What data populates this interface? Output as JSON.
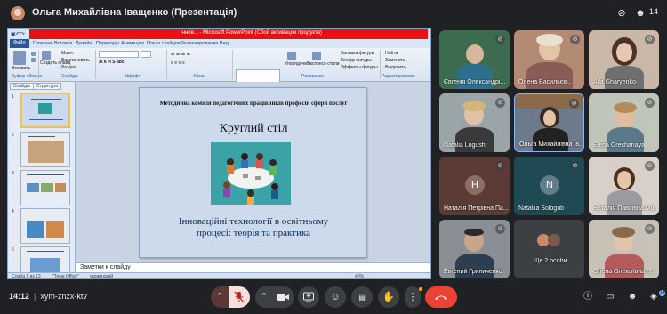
{
  "header": {
    "presenter": "Ольга Михайлівна Іващенко (Презентація)",
    "participant_count": "14"
  },
  "ppt": {
    "window_title": "Іннов... - Microsoft PowerPoint (Сбой активации продукта)",
    "menu": [
      "Файл",
      "Главная",
      "Вставка",
      "Дизайн",
      "Переходы",
      "Анимация",
      "Показ слайдов",
      "Рецензирование",
      "Вид"
    ],
    "ribbon_groups": [
      "Буфер обмена",
      "Слайды",
      "Шрифт",
      "Абзац",
      "Рисование",
      "Редактирование"
    ],
    "ribbon_labels": {
      "paste": "Вставить",
      "create_slide": "Создать слайд",
      "layout": "Макет",
      "restore": "Восстановить",
      "section": "Раздел",
      "arrange": "Упорядочить",
      "quick_styles": "Экспресс-стили",
      "shape_fill": "Заливка фигуры",
      "shape_outline": "Контур фигуры",
      "shape_effects": "Эффекты фигуры",
      "find": "Найти",
      "replace": "Заменить",
      "select": "Выделить"
    },
    "tabs": [
      "Слайды",
      "Структура"
    ],
    "slide_numbers": [
      "1",
      "2",
      "3",
      "4",
      "5"
    ],
    "slide": {
      "committee": "Методична комісія педагогічних працівників професій сфери послуг",
      "heading": "Круглий стіл",
      "topic_line1": "Інноваційні технології в освітньому",
      "topic_line2": "процесі: теорія та практика"
    },
    "notes_placeholder": "Заметки к слайду",
    "status": {
      "slide_of": "Слайд 1 из 13",
      "theme": "\"Тема Office\"",
      "language": "украинский",
      "zoom": "40%"
    }
  },
  "tiles": [
    {
      "name": "Євгенія Олександрі...",
      "muted": true,
      "kind": "photo",
      "bg": "#3d6b4f"
    },
    {
      "name": "Олена Васильєв...",
      "muted": true,
      "kind": "photo",
      "bg": "#b38a73"
    },
    {
      "name": "Alla Gharyenko",
      "muted": true,
      "kind": "photo",
      "bg": "#c9b8a8"
    },
    {
      "name": "Natalia Logush",
      "muted": true,
      "kind": "photo",
      "bg": "#9aa5a8"
    },
    {
      "name": "Ольга Михайлівна Ів...",
      "muted": true,
      "kind": "photo",
      "bg": "#6c7a8c"
    },
    {
      "name": "Elena Grechanaya",
      "muted": true,
      "kind": "photo",
      "bg": "#bfc5b8"
    },
    {
      "name": "Наталія Петрівна Па...",
      "muted": true,
      "kind": "letter",
      "letter": "Н",
      "bg": "#5a3b35",
      "circle": "#8d6e63"
    },
    {
      "name": "Nataliia Sologub",
      "muted": true,
      "kind": "letter",
      "letter": "N",
      "bg": "#1f4a54",
      "circle": "#607d8b"
    },
    {
      "name": "Наталія Павлівна Мо...",
      "muted": true,
      "kind": "photo",
      "bg": "#d8d0c8"
    },
    {
      "name": "Евгений Гриниченко",
      "muted": true,
      "kind": "photo",
      "bg": "#8a8f96"
    },
    {
      "name": "Ще 2 особи",
      "muted": false,
      "kind": "more",
      "bg": "#3c4043"
    },
    {
      "name": "Олена Олексіївна П...",
      "muted": true,
      "kind": "photo",
      "bg": "#c8c2b6"
    }
  ],
  "bottom": {
    "time": "14:12",
    "meeting_code": "xym-znzx-ktv"
  },
  "controls": {
    "more_icon": "chevron-up-icon",
    "mic_icon": "mic-off-icon",
    "cam_icon": "camera-icon",
    "present_icon": "present-icon",
    "emoji_icon": "emoji-icon",
    "cc_icon": "captions-icon",
    "hand_icon": "raise-hand-icon",
    "options_icon": "more-vert-icon",
    "end_icon": "end-call-icon"
  },
  "colors": {
    "end_call": "#ea4335",
    "mute_active": "#f9dedc",
    "accent": "#8ab4f8"
  }
}
